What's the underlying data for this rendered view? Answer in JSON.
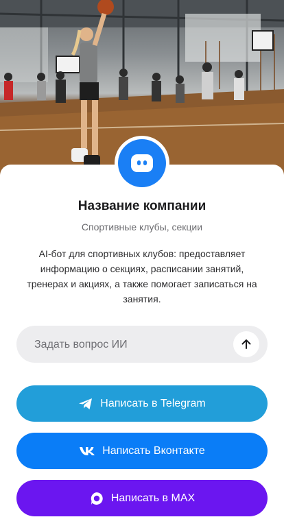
{
  "company": {
    "name": "Название компании",
    "category": "Спортивные клубы, секции",
    "description": "AI-бот для спортивных клубов: предоставляет информацию о секциях, расписании занятий, тренерах и акциях, а также помогает записаться на занятия."
  },
  "ask": {
    "placeholder": "Задать вопрос ИИ",
    "value": ""
  },
  "buttons": {
    "telegram": {
      "label": "Написать в Telegram",
      "color": "#229ed9",
      "icon": "telegram-icon"
    },
    "vk": {
      "label": "Написать Вконтакте",
      "color": "#0a7df7",
      "icon": "vk-icon"
    },
    "max": {
      "label": "Написать в MAX",
      "color": "#6b16f0",
      "icon": "max-icon"
    }
  },
  "colors": {
    "accent": "#1a7ff5",
    "input_bg": "#ededef"
  },
  "hero": {
    "icon": "basketball-gym-photo"
  }
}
